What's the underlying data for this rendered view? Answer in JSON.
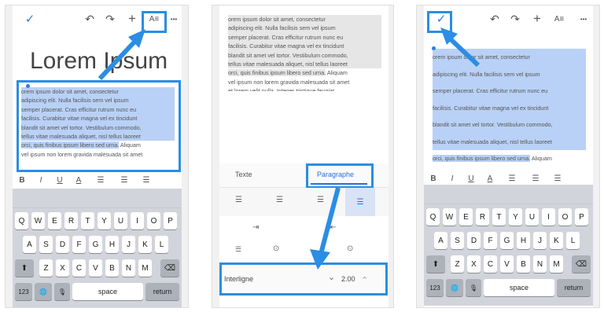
{
  "colors": {
    "accent": "#2b8de3",
    "selection": "#b9d1f6",
    "keyboard": "#d1d4da"
  },
  "toolbar": {
    "check_icon": "✓",
    "undo_icon": "↶",
    "redo_icon": "↷",
    "add_icon": "+",
    "format_icon": "A≡",
    "more_icon": "•••"
  },
  "doc": {
    "title": "Lorem Ipsum",
    "lines_left": [
      "orem  ipsum  dolor  sit  amet,  consectetur",
      "adipiscing  elit.  Nulla  facilisis  sem  vel  ipsum",
      "semper  placerat.  Cras  efficitur  rutrum  nunc  eu",
      "facilisis.  Curabitur  vitae  magna  vel  ex  tincidunt",
      "blandit sit amet vel tortor. Vestibulum commodo,",
      "tellus  vitae  malesuada  aliquet,  nisl  tellus  laoreet",
      "orci,  quis finibus ipsum libero sed urna."
    ],
    "aliquam": "Aliquam",
    "last_line": "vel ipsum non lorem gravida malesuada sit amet",
    "last_line_cut": "vel ipsum non lorem gravida malesuada sit amet",
    "cut_line": "et lorem velit nulla. Integer tristique feugiat"
  },
  "format_bar": {
    "bold": "B",
    "italic": "I",
    "underline": "U",
    "color": "A"
  },
  "keyboard": {
    "row1": [
      "Q",
      "W",
      "E",
      "R",
      "T",
      "Y",
      "U",
      "I",
      "O",
      "P"
    ],
    "row2": [
      "A",
      "S",
      "D",
      "F",
      "G",
      "H",
      "J",
      "K",
      "L"
    ],
    "row3": [
      "Z",
      "X",
      "C",
      "V",
      "B",
      "N",
      "M"
    ],
    "shift": "⬆",
    "backspace": "⌫",
    "numbers": "123",
    "globe": "🌐",
    "mic": "🎙",
    "space": "space",
    "return": "return"
  },
  "format_panel": {
    "tabs": [
      "Texte",
      "Paragraphe"
    ],
    "line_spacing_label": "Interligne",
    "line_spacing_value": "2.00",
    "down_icon": "⌄",
    "up_icon": "⌃"
  }
}
